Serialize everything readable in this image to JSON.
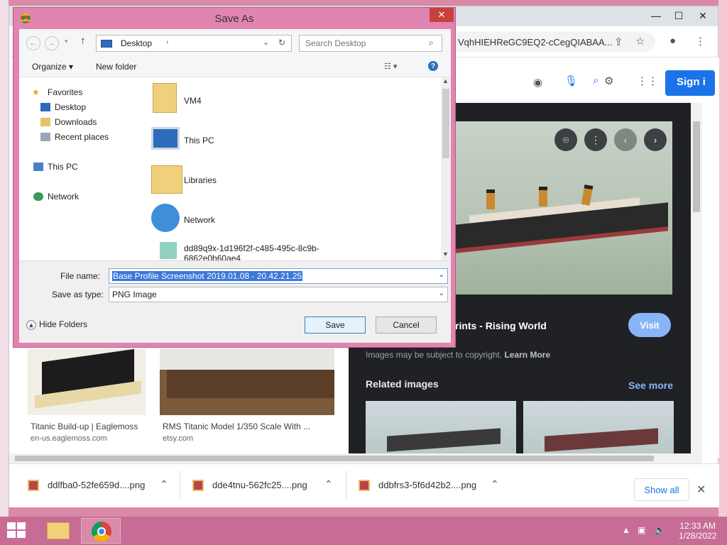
{
  "browser": {
    "omnibox_text": "VqhHIEHReGC9EQ2-cCegQIABAA...",
    "sign_in_label": "Sign i",
    "icons": [
      "share-icon",
      "star-icon",
      "profile-icon",
      "menu-icon",
      "camera-icon",
      "mic-icon",
      "lens-icon",
      "settings-icon",
      "apps-icon"
    ]
  },
  "panel": {
    "result_title": "rints - Rising World",
    "visit_label": "Visit",
    "copyright_text": "Images may be subject to copyright.",
    "learn_more": "Learn More",
    "related_label": "Related images",
    "see_more": "See more"
  },
  "cards": [
    {
      "title": "Titanic Build-up | Eaglemoss",
      "source": "en-us.eaglemoss.com"
    },
    {
      "title": "RMS Titanic Model 1/350 Scale With ...",
      "source": "etsy.com"
    }
  ],
  "downloads": {
    "items": [
      "ddlfba0-52fe659d....png",
      "dde4tnu-562fc25....png",
      "ddbfrs3-5f6d42b2....png"
    ],
    "show_all": "Show all"
  },
  "dialog": {
    "title": "Save As",
    "address": "Desktop",
    "search_placeholder": "Search Desktop",
    "organize": "Organize",
    "new_folder": "New folder",
    "tree": {
      "favorites": "Favorites",
      "desktop": "Desktop",
      "downloads": "Downloads",
      "recent": "Recent places",
      "this_pc": "This PC",
      "network": "Network"
    },
    "files": [
      "VM4",
      "This PC",
      "Libraries",
      "Network",
      "dd89q9x-1d196f2f-c485-495c-8c9b-6862e0b60ae4"
    ],
    "file_name_label": "File name:",
    "file_name_value": "Base Profile Screenshot 2019.01.08 - 20.42.21.25",
    "save_type_label": "Save as type:",
    "save_type_value": "PNG Image",
    "hide_folders": "Hide Folders",
    "save": "Save",
    "cancel": "Cancel"
  },
  "taskbar": {
    "time": "12:33 AM",
    "date": "1/28/2022"
  }
}
